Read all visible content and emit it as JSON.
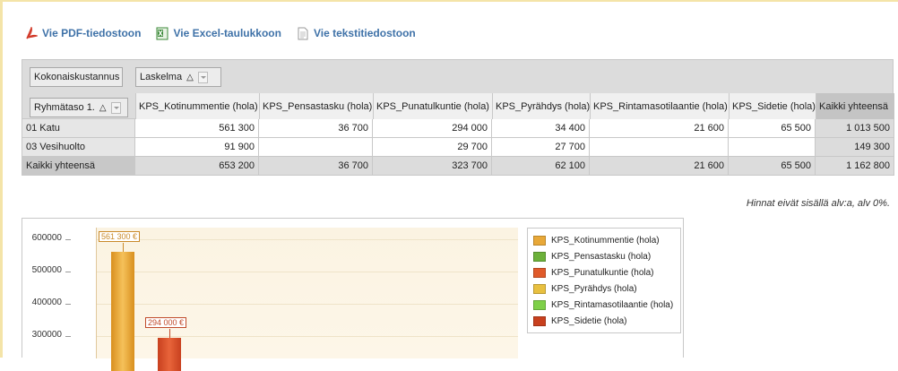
{
  "toolbar": {
    "pdf": "Vie PDF-tiedostoon",
    "excel": "Vie Excel-taulukkoon",
    "text": "Vie tekstitiedostoon"
  },
  "pivot": {
    "data_field": "Kokonaiskustannus",
    "column_field": "Laskelma",
    "row_field": "Ryhmätaso 1.",
    "sort_glyph": "△",
    "columns": [
      "KPS_Kotinummentie (hola)",
      "KPS_Pensastasku (hola)",
      "KPS_Punatulkuntie (hola)",
      "KPS_Pyrähdys (hola)",
      "KPS_Rintamasotilaantie (hola)",
      "KPS_Sidetie (hola)",
      "Kaikki yhteensä"
    ],
    "rows": [
      {
        "label": "01 Katu",
        "cells": [
          "561 300",
          "36 700",
          "294 000",
          "34 400",
          "21 600",
          "65 500",
          "1 013 500"
        ]
      },
      {
        "label": "03 Vesihuolto",
        "cells": [
          "91 900",
          "",
          "29 700",
          "27 700",
          "",
          "",
          "149 300"
        ]
      },
      {
        "label": "Kaikki yhteensä",
        "cells": [
          "653 200",
          "36 700",
          "323 700",
          "62 100",
          "21 600",
          "65 500",
          "1 162 800"
        ]
      }
    ]
  },
  "note": "Hinnat eivät sisällä alv:a, alv 0%.",
  "chart_data": {
    "type": "bar",
    "categories": [
      "KPS_Kotinummentie (hola)",
      "KPS_Pensastasku (hola)",
      "KPS_Punatulkuntie (hola)",
      "KPS_Pyrähdys (hola)",
      "KPS_Rintamasotilaantie (hola)",
      "KPS_Sidetie (hola)"
    ],
    "series": [
      {
        "name": "01 Katu",
        "values": [
          561300,
          36700,
          294000,
          34400,
          21600,
          65500
        ]
      }
    ],
    "value_labels": [
      "561 300 €",
      "294 000 €"
    ],
    "y_ticks": [
      "600000",
      "500000",
      "400000",
      "300000"
    ],
    "ylim_visible": [
      250000,
      620000
    ],
    "legend": [
      {
        "label": "KPS_Kotinummentie (hola)",
        "color": "#e8a838"
      },
      {
        "label": "KPS_Pensastasku (hola)",
        "color": "#6cb13a"
      },
      {
        "label": "KPS_Punatulkuntie (hola)",
        "color": "#e05a2a"
      },
      {
        "label": "KPS_Pyrähdys (hola)",
        "color": "#e8c040"
      },
      {
        "label": "KPS_Rintamasotilaantie (hola)",
        "color": "#7ed048"
      },
      {
        "label": "KPS_Sidetie (hola)",
        "color": "#c8401e"
      }
    ],
    "legend_position": "right"
  }
}
